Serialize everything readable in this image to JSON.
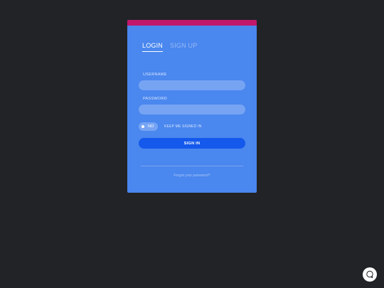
{
  "tabs": {
    "login": "LOGIN",
    "signup": "SIGN UP"
  },
  "form": {
    "username_label": "USERNAME",
    "password_label": "PASSWORD",
    "toggle_text": "NO",
    "keep_signed_in": "KEEP ME SIGNED IN",
    "signin_label": "SIGN IN",
    "forgot_password": "Forgot your password?"
  },
  "icons": {
    "chat": "chat-icon"
  },
  "colors": {
    "page_background": "#222327",
    "card_background": "#4a87ee",
    "card_topbar": "#c1186b",
    "button": "#1458ec"
  }
}
